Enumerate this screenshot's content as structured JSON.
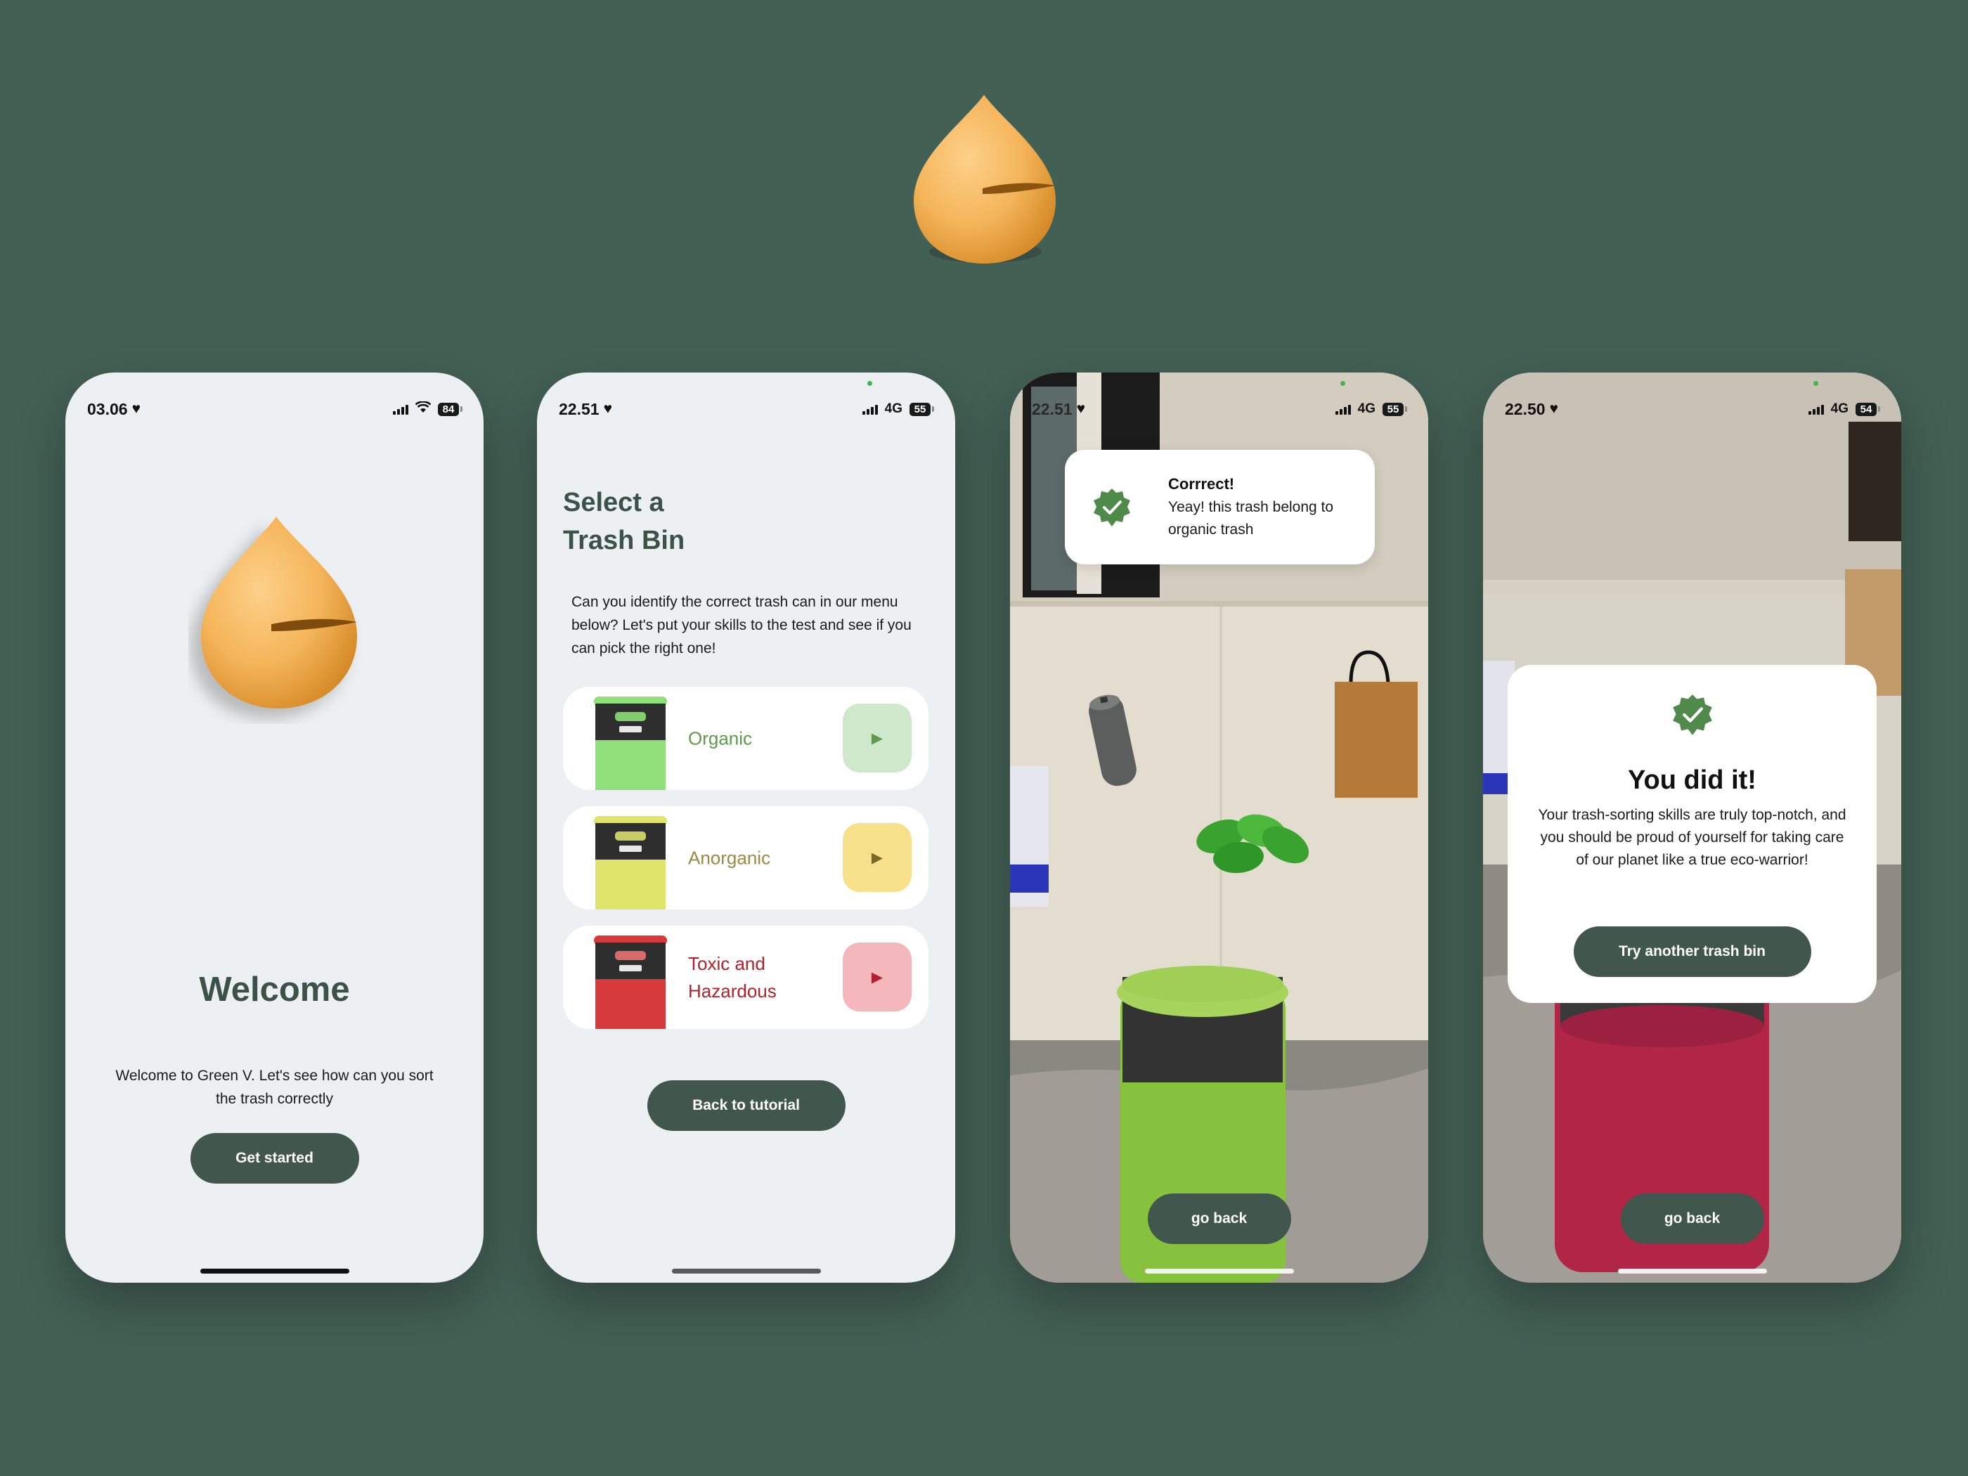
{
  "colors": {
    "background": "#436055",
    "primary_dark_green": "#41574e",
    "title_green": "#3c5249",
    "organic_green": "#5e9b4b",
    "anorganic_olive": "#9a8a44",
    "toxic_red": "#b3212b",
    "logo_orange": "#f8b85a"
  },
  "hero": {
    "icon": "orange-drop-logo-icon"
  },
  "phone1": {
    "status": {
      "time": "03.06",
      "battery": "84"
    },
    "title": "Welcome",
    "text": "Welcome to Green V. Let's see how can you sort the trash correctly",
    "button": "Get started"
  },
  "phone2": {
    "status": {
      "time": "22.51",
      "network": "4G",
      "battery": "55"
    },
    "title_line1": "Select a",
    "title_line2": "Trash Bin",
    "text": "Can you identify the correct trash can in our menu below? Let's put your skills to the test and see if you can pick the right one!",
    "bins": [
      {
        "label": "Organic",
        "icon": "play-icon"
      },
      {
        "label": "Anorganic",
        "icon": "play-icon"
      },
      {
        "label": "Toxic and Hazardous",
        "icon": "play-icon"
      }
    ],
    "button": "Back to tutorial"
  },
  "phone3": {
    "status": {
      "time": "22.51",
      "network": "4G",
      "battery": "55"
    },
    "toast": {
      "title": "Corrrect!",
      "text": "Yeay! this trash belong to organic trash",
      "icon": "verified-check-icon"
    },
    "button": "go back"
  },
  "phone4": {
    "status": {
      "time": "22.50",
      "network": "4G",
      "battery": "54"
    },
    "modal": {
      "icon": "verified-check-icon",
      "title": "You did it!",
      "text": "Your trash-sorting skills are truly top-notch, and you should be proud of yourself for taking care of our planet like a true eco-warrior!",
      "button": "Try another trash bin"
    },
    "button": "go back"
  }
}
